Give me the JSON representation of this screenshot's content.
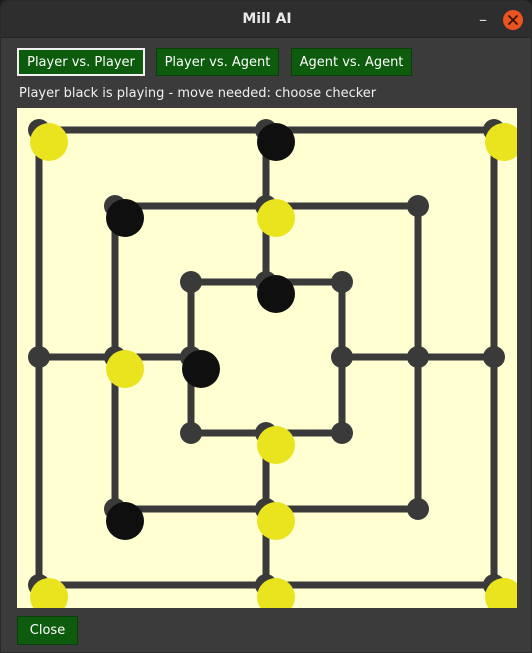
{
  "window": {
    "title": "Mill AI",
    "minimize_glyph": "–",
    "close_icon": "close-icon"
  },
  "modes": {
    "player_vs_player": "Player vs. Player",
    "player_vs_agent": "Player vs. Agent",
    "agent_vs_agent": "Agent vs. Agent",
    "selected": "player_vs_player"
  },
  "status": "Player black is playing - move needed: choose checker",
  "board": {
    "colors": {
      "background": "#ffffd2",
      "line": "#3a3a3a",
      "black": "#0f0f0f",
      "yellow": "#eae41e"
    },
    "points": [
      {
        "id": "a1",
        "piece": "yellow"
      },
      {
        "id": "d1",
        "piece": "black"
      },
      {
        "id": "g1",
        "piece": "yellow"
      },
      {
        "id": "b2",
        "piece": "black"
      },
      {
        "id": "d2",
        "piece": "yellow"
      },
      {
        "id": "f2",
        "piece": null
      },
      {
        "id": "c3",
        "piece": null
      },
      {
        "id": "d3",
        "piece": "black"
      },
      {
        "id": "e3",
        "piece": null
      },
      {
        "id": "a4",
        "piece": null
      },
      {
        "id": "b4",
        "piece": "yellow"
      },
      {
        "id": "c4",
        "piece": "black"
      },
      {
        "id": "e4",
        "piece": null
      },
      {
        "id": "f4",
        "piece": null
      },
      {
        "id": "g4",
        "piece": null
      },
      {
        "id": "c5",
        "piece": null
      },
      {
        "id": "d5",
        "piece": "yellow"
      },
      {
        "id": "e5",
        "piece": null
      },
      {
        "id": "b6",
        "piece": "black"
      },
      {
        "id": "d6",
        "piece": "yellow"
      },
      {
        "id": "f6",
        "piece": null
      },
      {
        "id": "a7",
        "piece": "yellow"
      },
      {
        "id": "d7",
        "piece": "yellow"
      },
      {
        "id": "g7",
        "piece": "yellow"
      }
    ]
  },
  "footer": {
    "close_label": "Close"
  }
}
